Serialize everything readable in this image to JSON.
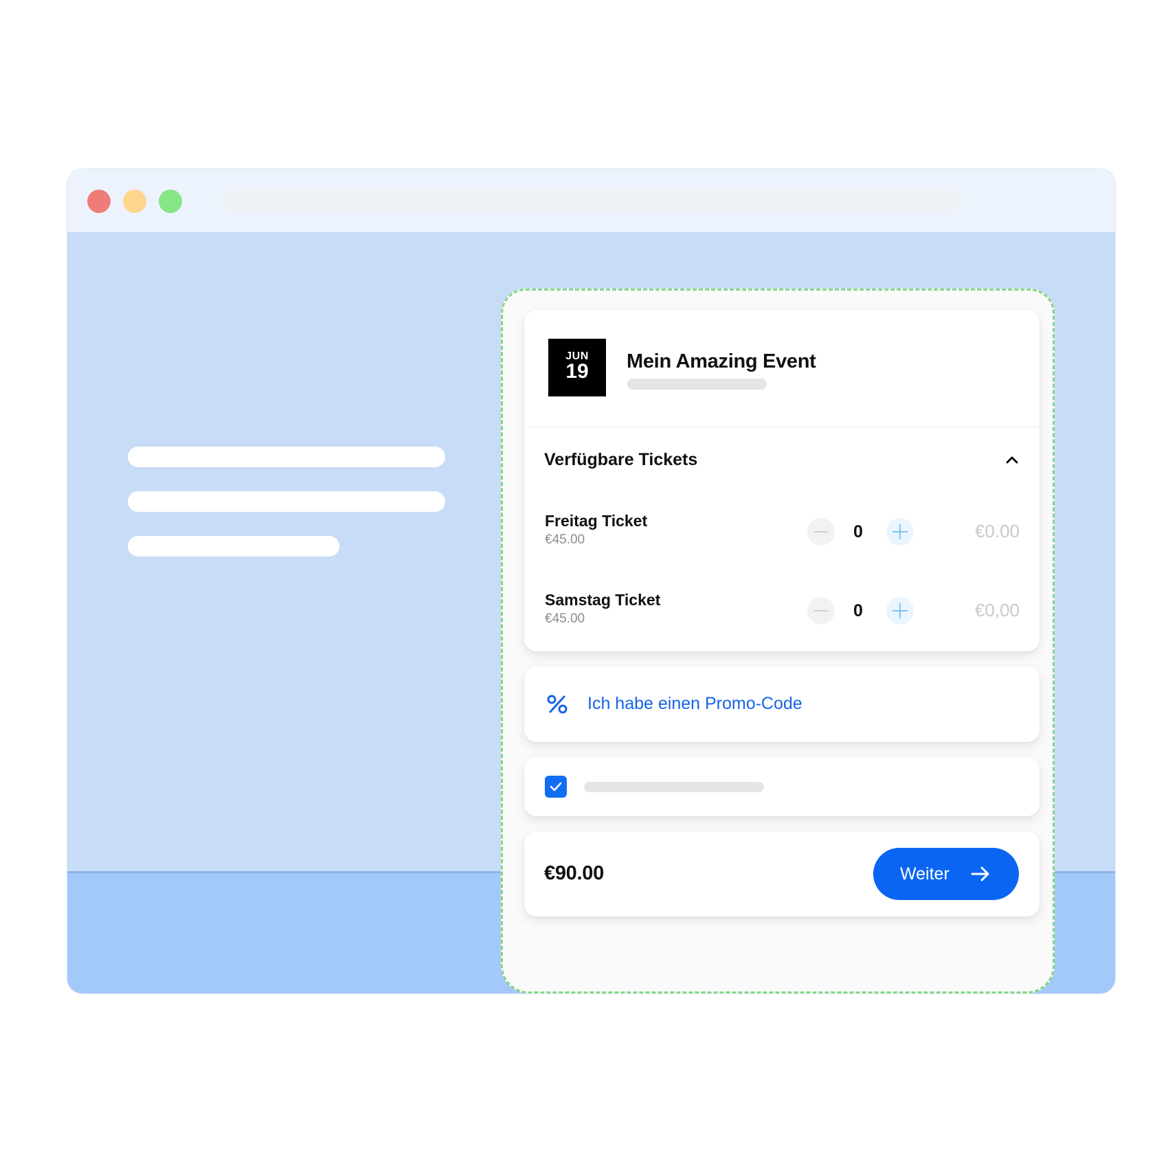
{
  "event": {
    "month": "JUN",
    "day": "19",
    "title": "Mein Amazing Event"
  },
  "tickets": {
    "section_title": "Verfügbare Tickets",
    "items": [
      {
        "name": "Freitag Ticket",
        "price": "€45.00",
        "quantity": "0",
        "line_total": "€0.00"
      },
      {
        "name": "Samstag Ticket",
        "price": "€45.00",
        "quantity": "0",
        "line_total": "€0,00"
      }
    ]
  },
  "promo": {
    "label": "Ich habe einen Promo-Code"
  },
  "checkout": {
    "total": "€90.00",
    "continue_label": "Weiter"
  },
  "colors": {
    "accent": "#0A65F3",
    "promo_text": "#1664E8",
    "window_content": "#C7DCF6",
    "footer_band": "#A3C9FB",
    "widget_border": "#85D685"
  },
  "icons": {
    "collapse": "chevron-up-icon",
    "decrement": "minus-icon",
    "increment": "plus-icon",
    "promo": "percent-icon",
    "consent": "checkmark-icon",
    "continue": "arrow-right-icon"
  }
}
